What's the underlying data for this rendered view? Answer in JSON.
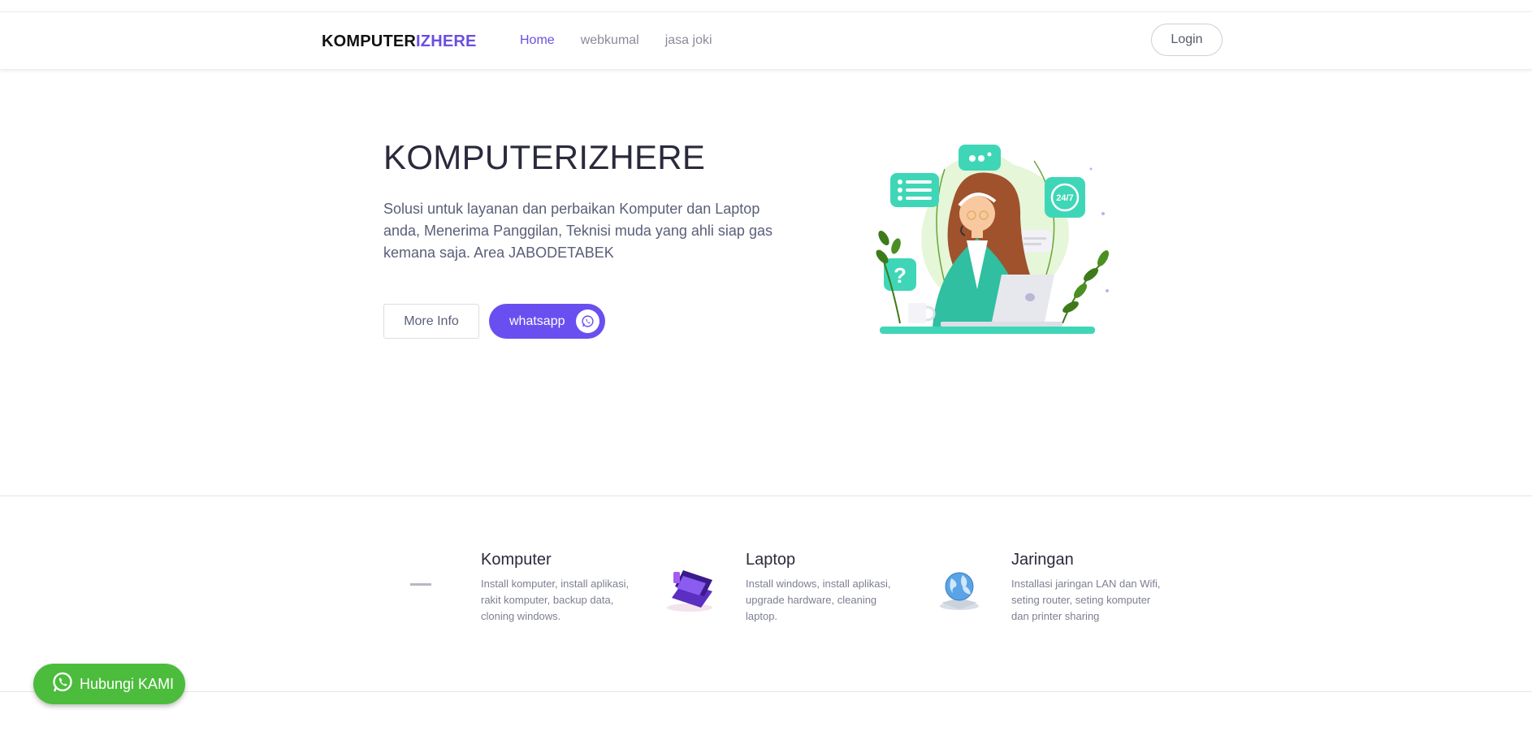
{
  "nav": {
    "brand_part1": "KOMPUTER",
    "brand_part2": "IZHERE",
    "links": [
      "Home",
      "webkumal",
      "jasa joki"
    ],
    "login_label": "Login"
  },
  "hero": {
    "title": "KOMPUTERIZHERE",
    "description": "Solusi untuk layanan dan perbaikan Komputer dan Laptop anda, Menerima Panggilan, Teknisi muda yang ahli siap gas kemana saja. Area JABODETABEK",
    "more_info_label": "More Info",
    "whatsapp_label": "whatsapp",
    "illustration_badge": "24/7"
  },
  "features": [
    {
      "title": "Komputer",
      "description": "Install komputer, install aplikasi, rakit komputer, backup data, cloning windows.",
      "icon": "computer-icon"
    },
    {
      "title": "Laptop",
      "description": "Install windows, install aplikasi, upgrade hardware, cleaning laptop.",
      "icon": "laptop-icon"
    },
    {
      "title": "Jaringan",
      "description": "Installasi jaringan LAN dan Wifi, seting router, seting komputer dan printer sharing",
      "icon": "globe-network-icon"
    }
  ],
  "floating": {
    "label": "Hubungi KAMI",
    "icon": "whatsapp-icon"
  },
  "colors": {
    "accent": "#6a4ff0",
    "whatsapp_green": "#4cbc3c",
    "teal": "#3fd6b8"
  }
}
